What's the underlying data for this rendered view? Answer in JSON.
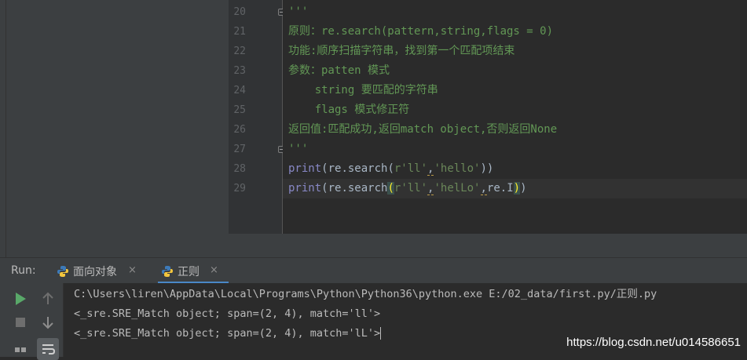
{
  "editor": {
    "lines": [
      {
        "n": "20",
        "tokens": [
          {
            "t": "'''",
            "c": "doc"
          }
        ]
      },
      {
        "n": "21",
        "tokens": [
          {
            "t": "原则：re.search(pattern,string,flags = 0)",
            "c": "doc"
          }
        ]
      },
      {
        "n": "22",
        "tokens": [
          {
            "t": "功能:顺序扫描字符串，找到第一个匹配项结束",
            "c": "doc"
          }
        ]
      },
      {
        "n": "23",
        "tokens": [
          {
            "t": "参数：patten 模式",
            "c": "doc"
          }
        ]
      },
      {
        "n": "24",
        "tokens": [
          {
            "t": "    string 要匹配的字符串",
            "c": "doc"
          }
        ]
      },
      {
        "n": "25",
        "tokens": [
          {
            "t": "    flags 模式修正符",
            "c": "doc"
          }
        ]
      },
      {
        "n": "26",
        "tokens": [
          {
            "t": "返回值:匹配成功,返回match object,否则返回None",
            "c": "doc"
          }
        ]
      },
      {
        "n": "27",
        "tokens": [
          {
            "t": "'''",
            "c": "doc"
          }
        ]
      },
      {
        "n": "28",
        "tokens": [
          {
            "t": "print",
            "c": "kw"
          },
          {
            "t": "(re.search(",
            "c": ""
          },
          {
            "t": "r'll'",
            "c": "str"
          },
          {
            "t": ",",
            "c": "warn"
          },
          {
            "t": "'hello'",
            "c": "str"
          },
          {
            "t": "))",
            "c": ""
          }
        ]
      },
      {
        "n": "29",
        "current": true,
        "tokens": [
          {
            "t": "print",
            "c": "kw"
          },
          {
            "t": "(re.search",
            "c": ""
          },
          {
            "t": "(",
            "c": "paren-hl"
          },
          {
            "t": "r'll'",
            "c": "str"
          },
          {
            "t": ",",
            "c": "warn"
          },
          {
            "t": "'helLo'",
            "c": "str"
          },
          {
            "t": ",",
            "c": "warn"
          },
          {
            "t": "re.I",
            "c": ""
          },
          {
            "t": ")",
            "c": "paren-hl"
          },
          {
            "t": ")",
            "c": ""
          }
        ]
      }
    ]
  },
  "run": {
    "label": "Run:",
    "tabs": [
      {
        "label": "面向对象",
        "active": false
      },
      {
        "label": "正则",
        "active": true
      }
    ],
    "close_glyph": "×"
  },
  "console": {
    "lines": [
      "C:\\Users\\liren\\AppData\\Local\\Programs\\Python\\Python36\\python.exe E:/02_data/first.py/正则.py",
      "<_sre.SRE_Match object; span=(2, 4), match='ll'>",
      "<_sre.SRE_Match object; span=(2, 4), match='lL'>"
    ]
  },
  "watermark": "https://blog.csdn.net/u014586651",
  "colors": {
    "run_green": "#59a869",
    "tab_active": "#4a88c7",
    "docstring": "#629755"
  }
}
